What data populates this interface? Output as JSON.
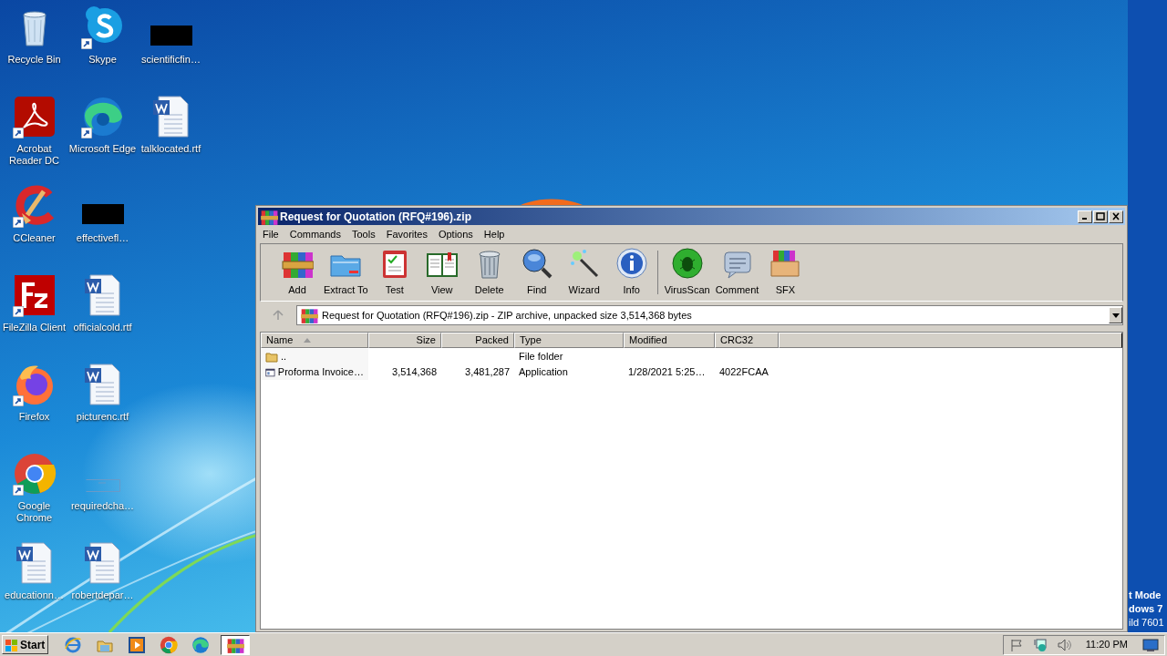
{
  "desktop": {
    "icon_rows": [
      [
        {
          "label": "Recycle Bin",
          "kind": "recycle",
          "shortcut": false
        },
        {
          "label": "Skype",
          "kind": "skype",
          "shortcut": true
        },
        {
          "label": "scientificfin…",
          "kind": "redacted",
          "shortcut": false
        }
      ],
      [
        {
          "label": "Acrobat Reader DC",
          "kind": "acrobat",
          "shortcut": true
        },
        {
          "label": "Microsoft Edge",
          "kind": "edge",
          "shortcut": true
        },
        {
          "label": "talklocated.rtf",
          "kind": "word",
          "shortcut": false
        }
      ],
      [
        {
          "label": "CCleaner",
          "kind": "ccleaner",
          "shortcut": true
        },
        {
          "label": "effectivefl…",
          "kind": "redacted",
          "shortcut": false
        }
      ],
      [
        {
          "label": "FileZilla Client",
          "kind": "filezilla",
          "shortcut": true
        },
        {
          "label": "officialcold.rtf",
          "kind": "word",
          "shortcut": false
        }
      ],
      [
        {
          "label": "Firefox",
          "kind": "firefox",
          "shortcut": true
        },
        {
          "label": "picturenc.rtf",
          "kind": "word",
          "shortcut": false
        }
      ],
      [
        {
          "label": "Google Chrome",
          "kind": "chrome",
          "shortcut": true
        },
        {
          "label": "requiredcha…",
          "kind": "blank",
          "shortcut": false
        }
      ],
      [
        {
          "label": "educationn…",
          "kind": "word",
          "shortcut": false
        },
        {
          "label": "robertdepar…",
          "kind": "word",
          "shortcut": false
        }
      ]
    ],
    "test_mode": [
      "t Mode",
      "dows 7",
      "ild 7601"
    ]
  },
  "window": {
    "title": "Request for Quotation (RFQ#196).zip",
    "menu": [
      "File",
      "Commands",
      "Tools",
      "Favorites",
      "Options",
      "Help"
    ],
    "toolbar": [
      {
        "label": "Add",
        "kind": "add"
      },
      {
        "label": "Extract To",
        "kind": "extract"
      },
      {
        "label": "Test",
        "kind": "test"
      },
      {
        "label": "View",
        "kind": "view"
      },
      {
        "label": "Delete",
        "kind": "delete"
      },
      {
        "label": "Find",
        "kind": "find"
      },
      {
        "label": "Wizard",
        "kind": "wizard"
      },
      {
        "label": "Info",
        "kind": "info"
      },
      {
        "label": "VirusScan",
        "kind": "virus"
      },
      {
        "label": "Comment",
        "kind": "comment"
      },
      {
        "label": "SFX",
        "kind": "sfx"
      }
    ],
    "address": "Request for Quotation (RFQ#196).zip - ZIP archive, unpacked size 3,514,368 bytes",
    "table": {
      "columns": [
        {
          "label": "Name",
          "sorted": true
        },
        {
          "label": "Size",
          "sorted": false
        },
        {
          "label": "Packed",
          "sorted": false
        },
        {
          "label": "Type",
          "sorted": false
        },
        {
          "label": "Modified",
          "sorted": false
        },
        {
          "label": "CRC32",
          "sorted": false
        }
      ],
      "rows": [
        {
          "kind": "folder",
          "cells": [
            "..",
            "",
            "",
            "File folder",
            "",
            ""
          ]
        },
        {
          "kind": "app",
          "cells": [
            "Proforma Invoice…",
            "3,514,368",
            "3,481,287",
            "Application",
            "1/28/2021 5:25…",
            "4022FCAA"
          ]
        }
      ]
    }
  },
  "taskbar": {
    "start": "Start",
    "apps": [
      {
        "kind": "ie",
        "selected": false
      },
      {
        "kind": "explorer",
        "selected": false
      },
      {
        "kind": "media",
        "selected": false
      },
      {
        "kind": "chrome",
        "selected": false
      },
      {
        "kind": "edge",
        "selected": false
      },
      {
        "kind": "winrar",
        "selected": true
      }
    ],
    "clock": "11:20 PM"
  }
}
